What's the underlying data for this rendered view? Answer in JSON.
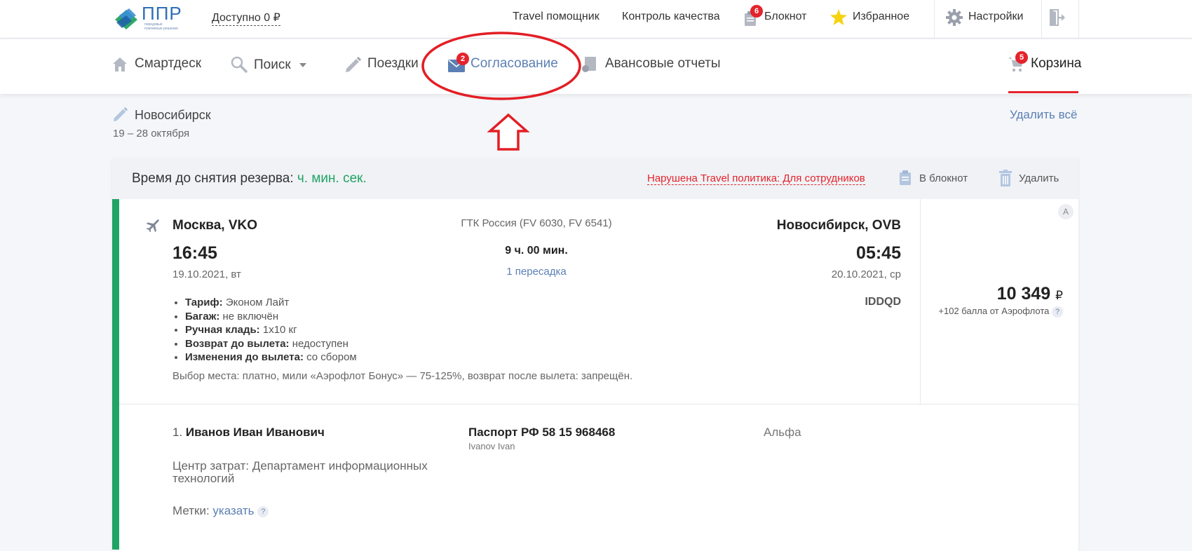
{
  "header": {
    "logo_text": "ППР",
    "logo_subtitle": "передовые платежные решения",
    "balance": "Доступно 0 ₽",
    "links": {
      "travel_helper": "Travel помощник",
      "quality": "Контроль качества",
      "notebook": "Блокнот",
      "notebook_count": "6",
      "favorites": "Избранное",
      "settings": "Настройки"
    }
  },
  "nav": {
    "smartdesk": "Смартдеск",
    "search": "Поиск",
    "trips": "Поездки",
    "approval": "Согласование",
    "approval_count": "2",
    "advance_reports": "Авансовые отчеты",
    "cart": "Корзина",
    "cart_count": "5"
  },
  "trip": {
    "destination": "Новосибирск",
    "dates": "19 – 28 октября",
    "delete_all": "Удалить всё"
  },
  "reservation": {
    "timer_label": "Время до снятия резерва:",
    "timer_value": "ч. мин. сек.",
    "policy_violation": "Нарушена Travel политика: Для сотрудников",
    "to_notebook": "В блокнот",
    "delete": "Удалить"
  },
  "flight": {
    "from_city": "Москва, VKO",
    "depart_time": "16:45",
    "depart_date": "19.10.2021, вт",
    "carrier": "ГТК Россия (FV 6030, FV 6541)",
    "duration": "9 ч. 00 мин.",
    "transfers": "1 пересадка",
    "to_city": "Новосибирск, OVB",
    "arrive_time": "05:45",
    "arrive_date": "20.10.2021, ср",
    "pnr": "IDDQD",
    "class_badge": "A",
    "price": "10 349",
    "currency": "₽",
    "bonus": "+102 балла от Аэрофлота",
    "help": "?",
    "terms": [
      {
        "label": "Тариф:",
        "value": "Эконом Лайт"
      },
      {
        "label": "Багаж:",
        "value": "не включён"
      },
      {
        "label": "Ручная кладь:",
        "value": "1x10 кг"
      },
      {
        "label": "Возврат до вылета:",
        "value": "недоступен"
      },
      {
        "label": "Изменения до вылета:",
        "value": "со сбором"
      }
    ],
    "seat_note": "Выбор места: платно, мили «Аэрофлот Бонус» — 75-125%, возврат после вылета: запрещён."
  },
  "passenger": {
    "index": "1.",
    "name": "Иванов Иван Иванович",
    "document": "Паспорт РФ 58 15 968468",
    "latin_name": "Ivanov Ivan",
    "company": "Альфа",
    "cost_center": "Центр затрат: Департамент информационных технологий",
    "tags_label": "Метки:",
    "tags_link": "указать",
    "help": "?"
  },
  "colors": {
    "accent_blue": "#5b7fb4",
    "green": "#21a366",
    "red": "#e4232c",
    "annotation_red": "#e31e24"
  }
}
